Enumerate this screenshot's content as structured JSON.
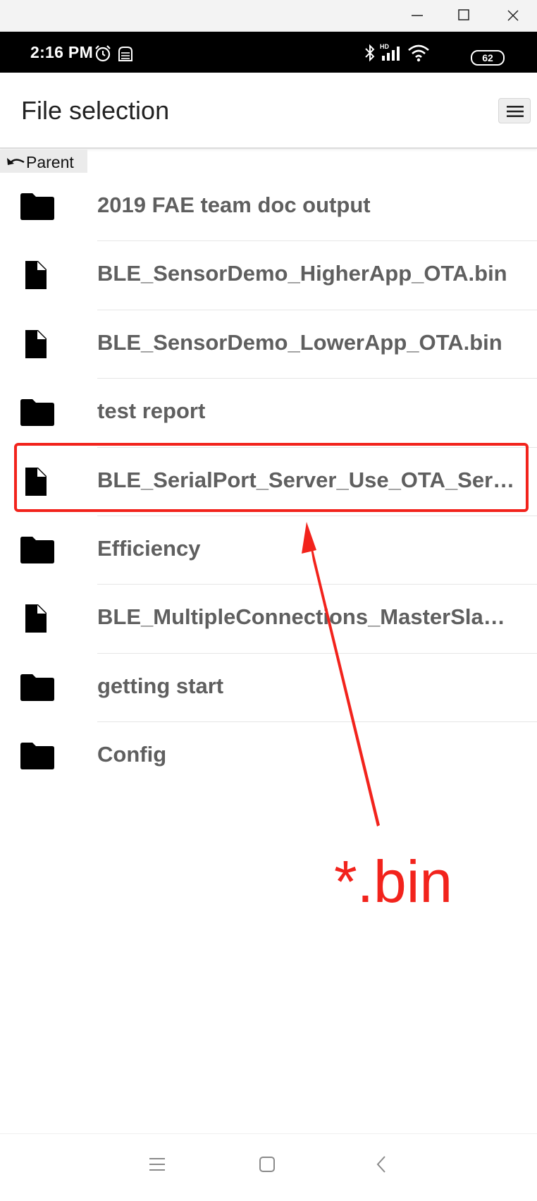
{
  "window": {
    "controls": [
      "minimize-icon",
      "maximize-icon",
      "close-icon"
    ]
  },
  "status_bar": {
    "time": "2:16 PM",
    "icons": [
      "alarm-icon",
      "sim-icon",
      "bluetooth-icon",
      "hd-signal-icon",
      "wifi-icon"
    ],
    "battery": "62"
  },
  "app_bar": {
    "title": "File selection",
    "menu_icon": "hamburger-menu-icon"
  },
  "parent_link": {
    "label": "Parent",
    "icon": "undo-icon"
  },
  "files": [
    {
      "name": "2019 FAE team doc output",
      "type": "folder"
    },
    {
      "name": "BLE_SensorDemo_HigherApp_OTA.bin",
      "type": "file"
    },
    {
      "name": "BLE_SensorDemo_LowerApp_OTA.bin",
      "type": "file"
    },
    {
      "name": "test report",
      "type": "folder"
    },
    {
      "name": "BLE_SerialPort_Server_Use_OTA_Server.bin",
      "type": "file"
    },
    {
      "name": "Efficiency",
      "type": "folder"
    },
    {
      "name": "BLE_MultipleConnections_MasterSlave.bin",
      "type": "file"
    },
    {
      "name": "getting start",
      "type": "folder"
    },
    {
      "name": "Config",
      "type": "folder"
    }
  ],
  "annotation": {
    "label": "*.bin",
    "color": "#f2231c",
    "highlighted_row": 4
  },
  "nav_bar": {
    "buttons": [
      "recents-icon",
      "home-icon",
      "back-icon"
    ]
  },
  "colors": {
    "text": "#5f5f5f",
    "status_bg": "#000000",
    "annotation": "#f2231c"
  }
}
